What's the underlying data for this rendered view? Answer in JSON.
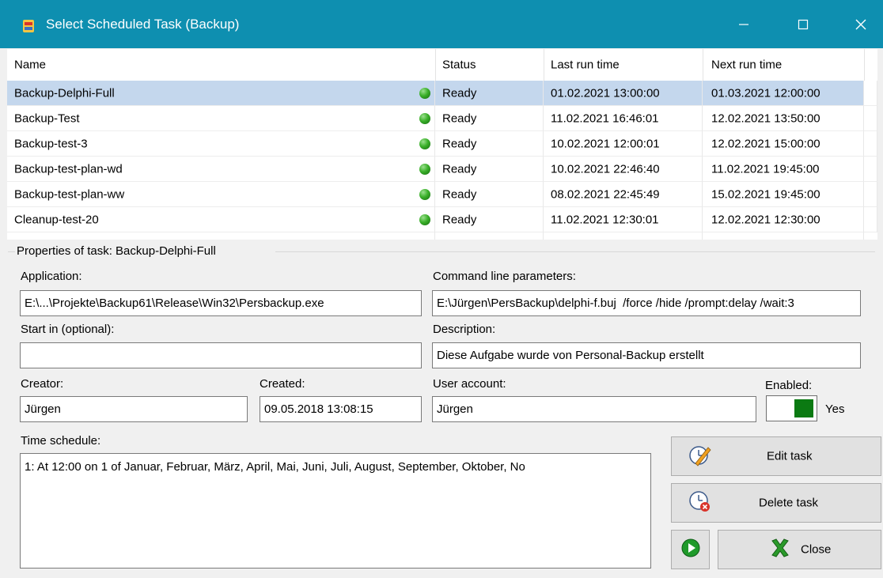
{
  "window": {
    "title": "Select Scheduled Task (Backup)"
  },
  "grid": {
    "columns": [
      "Name",
      "Status",
      "Last run time",
      "Next run time"
    ],
    "rows": [
      {
        "name": "Backup-Delphi-Full",
        "status": "Ready",
        "last_run": "01.02.2021 13:00:00",
        "next_run": "01.03.2021 12:00:00",
        "selected": true
      },
      {
        "name": "Backup-Test",
        "status": "Ready",
        "last_run": "11.02.2021 16:46:01",
        "next_run": "12.02.2021 13:50:00"
      },
      {
        "name": "Backup-test-3",
        "status": "Ready",
        "last_run": "10.02.2021 12:00:01",
        "next_run": "12.02.2021 15:00:00"
      },
      {
        "name": "Backup-test-plan-wd",
        "status": "Ready",
        "last_run": "10.02.2021 22:46:40",
        "next_run": "11.02.2021 19:45:00"
      },
      {
        "name": "Backup-test-plan-ww",
        "status": "Ready",
        "last_run": "08.02.2021 22:45:49",
        "next_run": "15.02.2021 19:45:00"
      },
      {
        "name": "Cleanup-test-20",
        "status": "Ready",
        "last_run": "11.02.2021 12:30:01",
        "next_run": "12.02.2021 12:30:00"
      }
    ],
    "status_color": "#3bb02a",
    "selected_color": "#c4d7ed"
  },
  "properties": {
    "group_label": "Properties of task: Backup-Delphi-Full",
    "application_label": "Application:",
    "application_value": "E:\\...\\Projekte\\Backup61\\Release\\Win32\\Persbackup.exe",
    "cmdline_label": "Command line parameters:",
    "cmdline_value": "E:\\Jürgen\\PersBackup\\delphi-f.buj  /force /hide /prompt:delay /wait:3",
    "startin_label": "Start in (optional):",
    "startin_value": "",
    "description_label": "Description:",
    "description_value": "Diese Aufgabe wurde von Personal-Backup erstellt",
    "creator_label": "Creator:",
    "creator_value": "Jürgen",
    "created_label": "Created:",
    "created_value": "09.05.2018 13:08:15",
    "user_label": "User account:",
    "user_value": "Jürgen",
    "enabled_label": "Enabled:",
    "enabled_value": "Yes",
    "schedule_label": "Time schedule:",
    "schedule_value": "1: At 12:00 on 1 of Januar, Februar, März, April, Mai, Juni, Juli, August, September, Oktober, No"
  },
  "buttons": {
    "edit": "Edit task",
    "delete": "Delete task",
    "close": "Close"
  },
  "colors": {
    "titlebar": "#0e8fb0",
    "toggle_on": "#0b7a12"
  },
  "icons": [
    "app-icon",
    "minimize-icon",
    "maximize-icon",
    "close-window-icon",
    "status-ready-icon",
    "edit-task-icon",
    "delete-task-icon",
    "run-icon",
    "close-x-icon"
  ]
}
